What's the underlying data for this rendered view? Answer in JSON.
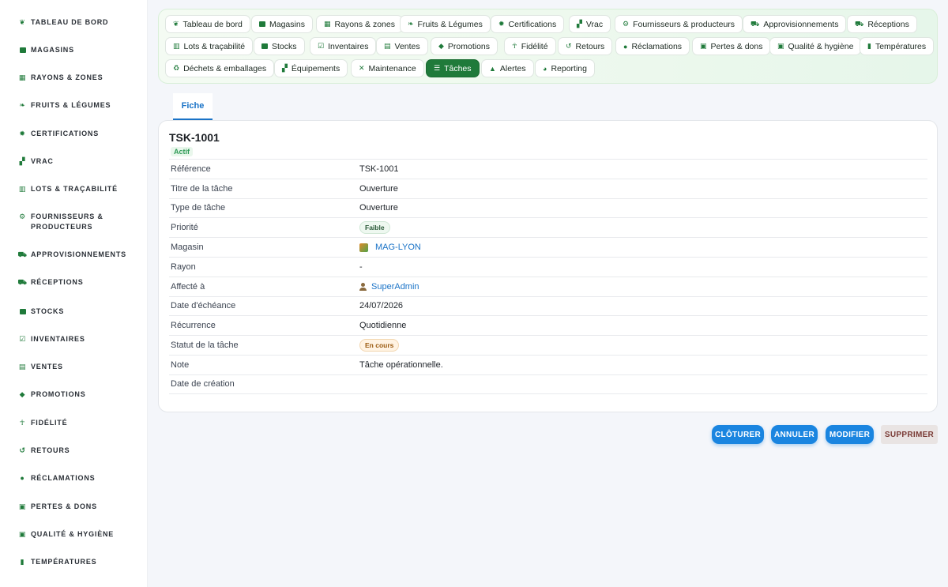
{
  "sidebar": {
    "items": [
      {
        "label": "Tableau de bord",
        "icon": "seedling-icon"
      },
      {
        "label": "Magasins",
        "icon": "store-icon"
      },
      {
        "label": "Rayons & zones",
        "icon": "grid-icon"
      },
      {
        "label": "Fruits & Légumes",
        "icon": "leaf-icon"
      },
      {
        "label": "Certifications",
        "icon": "certificate-icon"
      },
      {
        "label": "Vrac",
        "icon": "boxes-icon"
      },
      {
        "label": "Lots & traçabilité",
        "icon": "barcode-icon"
      },
      {
        "label": "Fournisseurs & producteurs",
        "icon": "tractor-icon"
      },
      {
        "label": "Approvisionnements",
        "icon": "cart-icon"
      },
      {
        "label": "Réceptions",
        "icon": "truck-icon"
      },
      {
        "label": "Stocks",
        "icon": "warehouse-icon"
      },
      {
        "label": "Inventaires",
        "icon": "clipboard-check-icon"
      },
      {
        "label": "Ventes",
        "icon": "cash-register-icon"
      },
      {
        "label": "Promotions",
        "icon": "tag-icon"
      },
      {
        "label": "Fidélité",
        "icon": "award-icon"
      },
      {
        "label": "Retours",
        "icon": "undo-icon"
      },
      {
        "label": "Réclamations",
        "icon": "comment-icon"
      },
      {
        "label": "Pertes & dons",
        "icon": "trash-icon"
      },
      {
        "label": "Qualité & hygiène",
        "icon": "clipboard-icon"
      },
      {
        "label": "Températures",
        "icon": "thermometer-icon"
      }
    ]
  },
  "topnav": {
    "items": [
      {
        "label": "Tableau de bord",
        "icon": "seedling-icon"
      },
      {
        "label": "Magasins",
        "icon": "store-icon"
      },
      {
        "label": "Rayons & zones",
        "icon": "grid-icon"
      },
      {
        "label": "Fruits & Légumes",
        "icon": "leaf-icon"
      },
      {
        "label": "Certifications",
        "icon": "certificate-icon"
      },
      {
        "label": "Vrac",
        "icon": "boxes-icon"
      },
      {
        "label": "Fournisseurs & producteurs",
        "icon": "tractor-icon"
      },
      {
        "label": "Approvisionnements",
        "icon": "cart-icon"
      },
      {
        "label": "Réceptions",
        "icon": "truck-icon"
      },
      {
        "label": "Lots & traçabilité",
        "icon": "barcode-icon"
      },
      {
        "label": "Stocks",
        "icon": "warehouse-icon"
      },
      {
        "label": "Inventaires",
        "icon": "clipboard-check-icon"
      },
      {
        "label": "Ventes",
        "icon": "cash-register-icon"
      },
      {
        "label": "Promotions",
        "icon": "tag-icon"
      },
      {
        "label": "Fidélité",
        "icon": "award-icon"
      },
      {
        "label": "Retours",
        "icon": "undo-icon"
      },
      {
        "label": "Réclamations",
        "icon": "comment-icon"
      },
      {
        "label": "Pertes & dons",
        "icon": "trash-icon"
      },
      {
        "label": "Qualité & hygiène",
        "icon": "clipboard-icon"
      },
      {
        "label": "Températures",
        "icon": "thermometer-icon"
      },
      {
        "label": "Déchets & emballages",
        "icon": "recycle-icon"
      },
      {
        "label": "Équipements",
        "icon": "equipment-icon"
      },
      {
        "label": "Maintenance",
        "icon": "tools-icon"
      },
      {
        "label": "Tâches",
        "icon": "tasks-icon",
        "active": true
      },
      {
        "label": "Alertes",
        "icon": "bell-icon"
      },
      {
        "label": "Reporting",
        "icon": "chart-pie-icon"
      }
    ]
  },
  "tabs": [
    {
      "label": "Fiche",
      "active": true
    }
  ],
  "record": {
    "title": "TSK-1001",
    "status": "Actif",
    "fields": [
      {
        "label": "Référence",
        "value": "TSK-1001"
      },
      {
        "label": "Titre de la tâche",
        "value": "Ouverture"
      },
      {
        "label": "Type de tâche",
        "value": "Ouverture"
      },
      {
        "label": "Priorité",
        "value": "Faible",
        "kind": "chip"
      },
      {
        "label": "Magasin",
        "value": "MAG-LYON",
        "kind": "link",
        "icon": "store-badge-icon"
      },
      {
        "label": "Rayon",
        "value": "-",
        "kind": "dash"
      },
      {
        "label": "Affecté à",
        "value": "SuperAdmin",
        "kind": "link",
        "icon": "user-icon"
      },
      {
        "label": "Date d'échéance",
        "value": "24/07/2026"
      },
      {
        "label": "Récurrence",
        "value": "Quotidienne"
      },
      {
        "label": "Statut de la tâche",
        "value": "En cours",
        "kind": "chip-orange"
      },
      {
        "label": "Note",
        "value": "Tâche opérationnelle."
      },
      {
        "label": "Date de création",
        "value": ""
      }
    ]
  },
  "actions": {
    "close": "Clôturer",
    "cancel": "Annuler",
    "edit": "Modifier",
    "delete": "Supprimer"
  },
  "colors": {
    "accent_green": "#1f7a3a",
    "accent_blue": "#1a85e0",
    "link_blue": "#1a73c7"
  }
}
